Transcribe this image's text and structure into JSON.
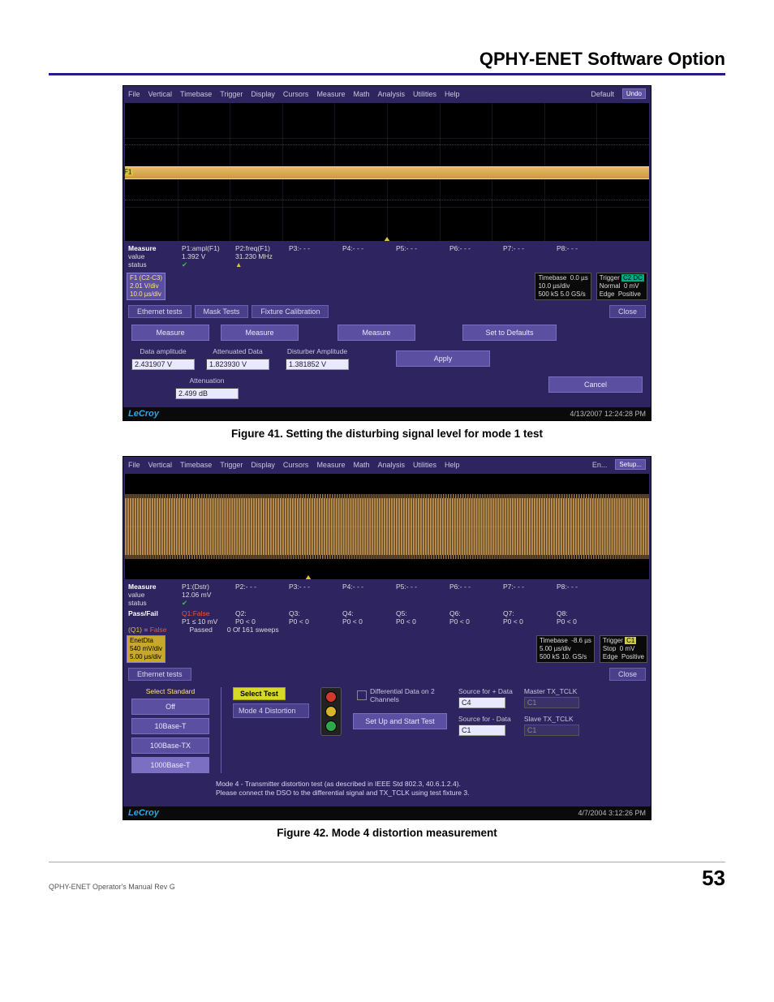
{
  "header": {
    "title": "QPHY-ENET Software Option"
  },
  "figure1": {
    "menubar": [
      "File",
      "Vertical",
      "Timebase",
      "Trigger",
      "Display",
      "Cursors",
      "Measure",
      "Math",
      "Analysis",
      "Utilities",
      "Help"
    ],
    "menu_right": "Default",
    "menu_undo": "Undo",
    "f_label": "F1",
    "measure_labels": {
      "title": "Measure",
      "value": "value",
      "status": "status"
    },
    "p1": {
      "name": "P1:ampl(F1)",
      "value": "1.392 V"
    },
    "p2": {
      "name": "P2:freq(F1)",
      "value": "31.230 MHz"
    },
    "p_blank": [
      "P3:- - -",
      "P4:- - -",
      "P5:- - -",
      "P6:- - -",
      "P7:- - -",
      "P8:- - -"
    ],
    "chan": {
      "name": "F1       (C2-C3)",
      "l2": "2.01 V/div",
      "l3": "10.0 µs/div"
    },
    "timebase": {
      "title": "Timebase",
      "v1": "0.0 µs",
      "v2": "10.0 µs/div",
      "v3": "500 kS    5.0 GS/s"
    },
    "trigger": {
      "title": "Trigger",
      "v1": "Normal",
      "v2": "Edge",
      "tag": "C2 DC",
      "v3": "0 mV",
      "v4": "Positive"
    },
    "tabs": {
      "t1": "Ethernet tests",
      "t2": "Mask Tests",
      "t3": "Fixture Calibration",
      "close": "Close"
    },
    "buttons": {
      "measure": "Measure",
      "defaults": "Set to Defaults",
      "apply": "Apply",
      "cancel": "Cancel"
    },
    "fields": {
      "data_amp_label": "Data amplitude",
      "data_amp_val": "2.431907 V",
      "atten_data_label": "Attenuated Data",
      "atten_data_val": "1.823930 V",
      "dist_amp_label": "Disturber Amplitude",
      "dist_amp_val": "1.381852 V",
      "atten_label": "Attenuation",
      "atten_val": "2.499 dB"
    },
    "footer_brand": "LeCroy",
    "footer_time": "4/13/2007 12:24:28 PM",
    "caption": "Figure 41. Setting the disturbing signal level for mode 1 test"
  },
  "figure2": {
    "menubar": [
      "File",
      "Vertical",
      "Timebase",
      "Trigger",
      "Display",
      "Cursors",
      "Measure",
      "Math",
      "Analysis",
      "Utilities",
      "Help"
    ],
    "menu_right": "En...",
    "menu_setup": "Setup...",
    "measure_labels": {
      "title": "Measure",
      "value": "value",
      "status": "status"
    },
    "p1": {
      "name": "P1:(Dstr)",
      "value": "12.06 mV"
    },
    "p_blank": [
      "P2:- - -",
      "P3:- - -",
      "P4:- - -",
      "P5:- - -",
      "P6:- - -",
      "P7:- - -",
      "P8:- - -"
    ],
    "passfail_title": "Pass/Fail",
    "q_line": {
      "q1": "Q1:False",
      "q2": "Q2:",
      "q3": "Q3:",
      "q4": "Q4:",
      "q5": "Q5:",
      "q6": "Q6:",
      "q7": "Q7:",
      "q8": "Q8:"
    },
    "p_line": {
      "p1": "P1 ≤ 10 mV",
      "rest": "P0 < 0"
    },
    "result_line": {
      "label": "(Q1) =",
      "val": "False",
      "passed": "Passed",
      "count": "0   Of   161  sweeps"
    },
    "chan": {
      "name": "EnetDta",
      "l2": "540 mV/div",
      "l3": "5.00 µs/div"
    },
    "timebase": {
      "title": "Timebase",
      "v1": "-8.6 µs",
      "v2": "5.00 µs/div",
      "v3": "500 kS    10. GS/s"
    },
    "trigger": {
      "title": "Trigger",
      "tag": "C1",
      "v1": "Stop",
      "v2": "Edge",
      "v3": "0 mV",
      "v4": "Positive"
    },
    "tabs": {
      "t1": "Ethernet tests",
      "close": "Close"
    },
    "panel": {
      "std_label": "Select Standard",
      "off": "Off",
      "tenb": "10Base-T",
      "hunb": "100Base-TX",
      "thob": "1000Base-T",
      "select_test": "Select Test",
      "mode4": "Mode 4 Distortion",
      "diff_label": "Differential Data on 2 Channels",
      "setup_btn": "Set Up and Start Test",
      "src_pos_label": "Source for + Data",
      "src_pos_val": "C4",
      "src_neg_label": "Source for - Data",
      "src_neg_val": "C1",
      "master_label": "Master TX_TCLK",
      "master_val": "C1",
      "slave_label": "Slave TX_TCLK",
      "slave_val": "C1",
      "note_l1": "Mode 4 - Transmitter distortion test (as described in IEEE Std 802.3, 40.6.1.2.4).",
      "note_l2": "Please connect the DSO to the differential signal and TX_TCLK using test fixture 3."
    },
    "footer_brand": "LeCroy",
    "footer_time": "4/7/2004 3:12:26 PM",
    "caption": "Figure 42. Mode 4 distortion measurement"
  },
  "page_footer": {
    "left": "QPHY-ENET Operator's Manual Rev G",
    "right": "53"
  }
}
